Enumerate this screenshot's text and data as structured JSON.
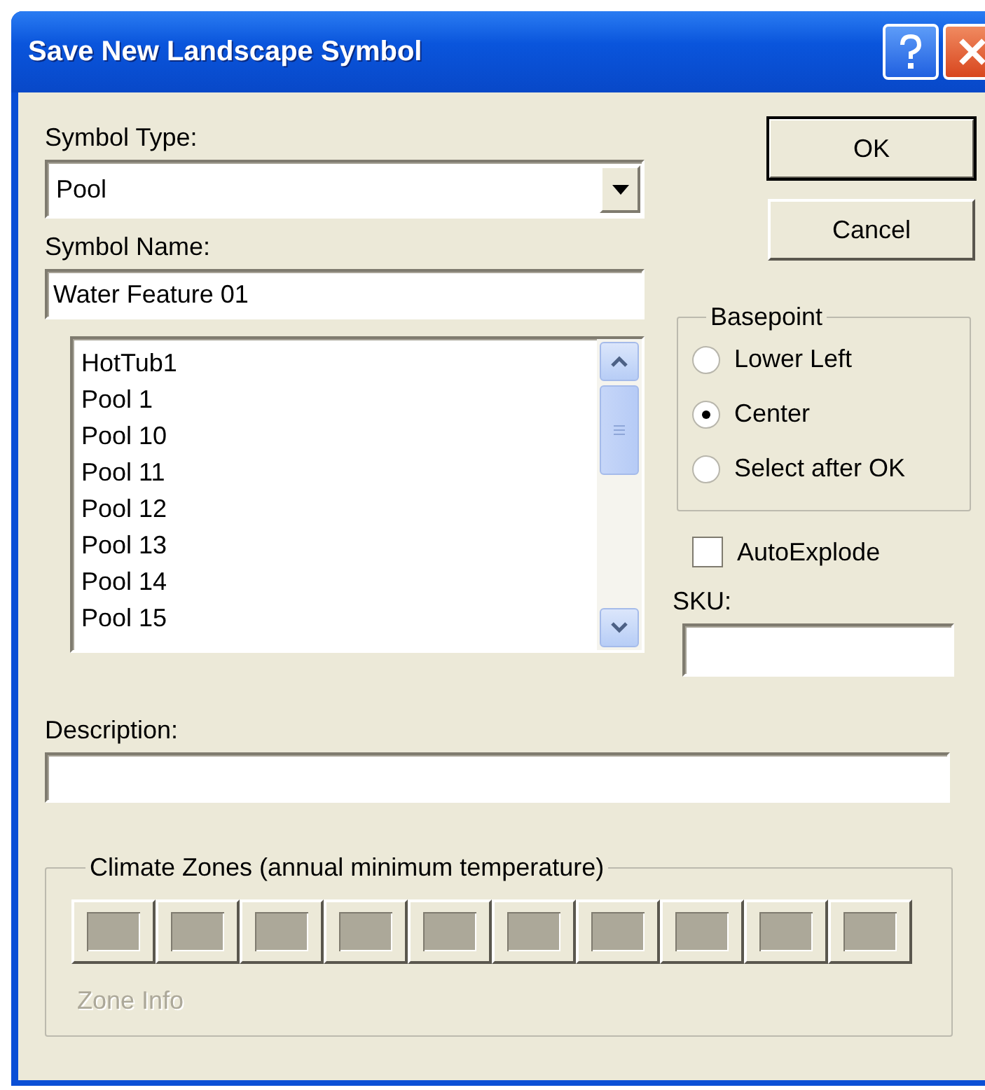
{
  "window": {
    "title": "Save New Landscape Symbol"
  },
  "symbol_type": {
    "label": "Symbol Type:",
    "value": "Pool"
  },
  "symbol_name": {
    "label": "Symbol Name:",
    "value": "Water Feature 01"
  },
  "symbol_list": [
    "HotTub1",
    "Pool 1",
    "Pool 10",
    "Pool 11",
    "Pool 12",
    "Pool 13",
    "Pool 14",
    "Pool 15"
  ],
  "buttons": [
    {
      "label": "OK",
      "default": true
    },
    {
      "label": "Cancel",
      "default": false
    }
  ],
  "basepoint": {
    "title": "Basepoint",
    "options": [
      {
        "label": "Lower Left",
        "selected": false
      },
      {
        "label": "Center",
        "selected": true
      },
      {
        "label": "Select after OK",
        "selected": false
      }
    ]
  },
  "auto_explode": {
    "label": "AutoExplode",
    "checked": false
  },
  "sku": {
    "label": "SKU:"
  },
  "description": {
    "label": "Description:"
  },
  "climate_zones": {
    "title": "Climate Zones (annual minimum temperature)",
    "zones": [
      {
        "disabled": true
      },
      {
        "disabled": true
      },
      {
        "disabled": true
      },
      {
        "disabled": true
      },
      {
        "disabled": true
      },
      {
        "disabled": true
      },
      {
        "disabled": true
      },
      {
        "disabled": true
      },
      {
        "disabled": true
      },
      {
        "disabled": true
      }
    ],
    "zone_info": {
      "label": "Zone Info",
      "disabled": true
    }
  }
}
